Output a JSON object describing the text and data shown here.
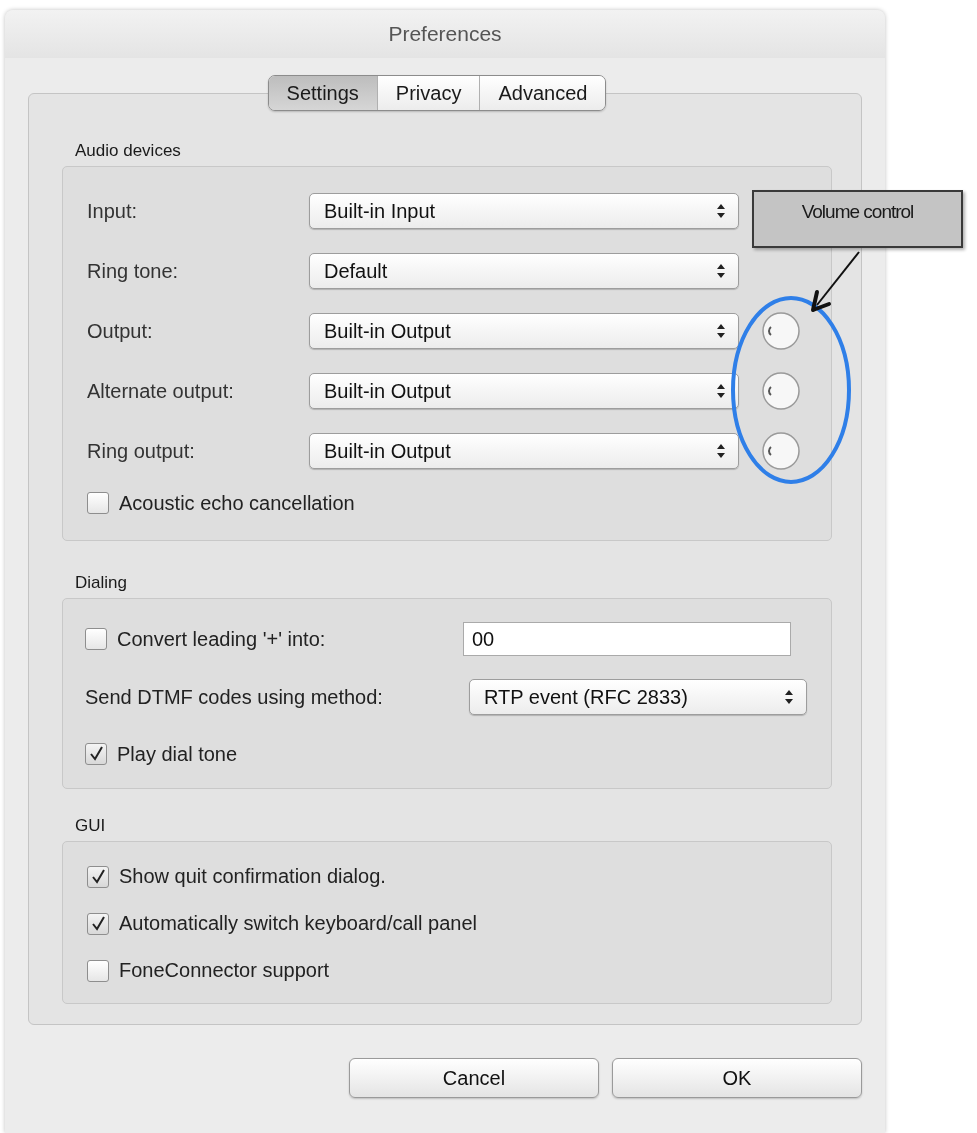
{
  "window": {
    "title": "Preferences"
  },
  "tabs": [
    {
      "label": "Settings",
      "selected": true
    },
    {
      "label": "Privacy",
      "selected": false
    },
    {
      "label": "Advanced",
      "selected": false
    }
  ],
  "audio_devices": {
    "title": "Audio devices",
    "rows": [
      {
        "label": "Input:",
        "value": "Built-in Input"
      },
      {
        "label": "Ring tone:",
        "value": "Default"
      },
      {
        "label": "Output:",
        "value": "Built-in Output",
        "has_volume_knob": true
      },
      {
        "label": "Alternate output:",
        "value": "Built-in Output",
        "has_volume_knob": true
      },
      {
        "label": "Ring output:",
        "value": "Built-in Output",
        "has_volume_knob": true
      }
    ],
    "echo_cancellation": {
      "label": "Acoustic echo cancellation",
      "checked": false
    }
  },
  "dialing": {
    "title": "Dialing",
    "convert_plus": {
      "label": "Convert leading '+' into:",
      "checked": false,
      "value": "00"
    },
    "dtmf": {
      "label": "Send DTMF codes using method:",
      "value": "RTP event (RFC 2833)"
    },
    "dial_tone": {
      "label": "Play dial tone",
      "checked": true
    }
  },
  "gui": {
    "title": "GUI",
    "options": [
      {
        "label": "Show quit confirmation dialog.",
        "checked": true
      },
      {
        "label": "Automatically switch keyboard/call panel",
        "checked": true
      },
      {
        "label": "FoneConnector support",
        "checked": false
      }
    ]
  },
  "buttons": [
    "Cancel",
    "OK"
  ],
  "annotation": {
    "label": "Volume control"
  }
}
